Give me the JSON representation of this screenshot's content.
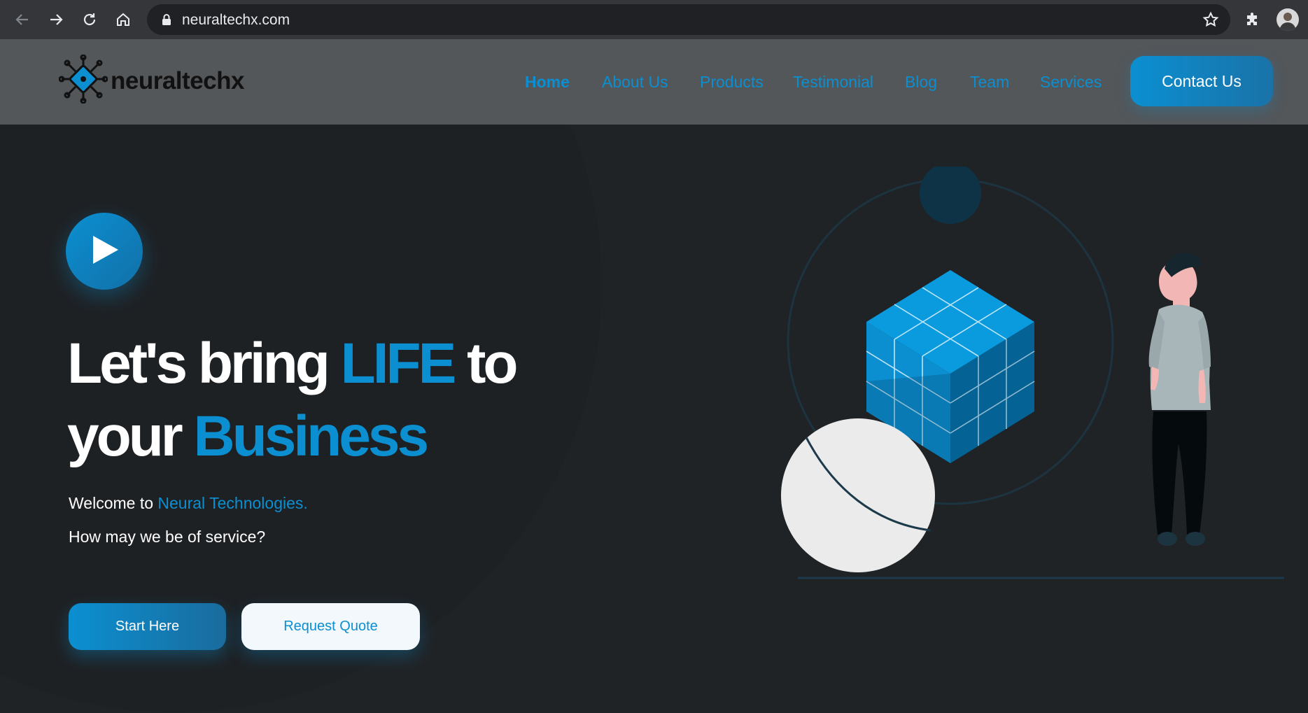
{
  "browser": {
    "url": "neuraltechx.com",
    "back_icon": "arrow-left-icon",
    "forward_icon": "arrow-right-icon",
    "reload_icon": "reload-icon",
    "home_icon": "home-icon",
    "lock_icon": "lock-icon",
    "bookmark_icon": "star-icon",
    "extensions_icon": "puzzle-icon"
  },
  "header": {
    "logo_text": "neuraltechx",
    "nav": [
      {
        "label": "Home",
        "active": true
      },
      {
        "label": "About Us"
      },
      {
        "label": "Products"
      },
      {
        "label": "Testimonial"
      },
      {
        "label": "Blog"
      },
      {
        "label": "Team"
      },
      {
        "label": "Services"
      }
    ],
    "contact_label": "Contact Us"
  },
  "hero": {
    "headline_1": "Let's bring ",
    "headline_accent_1": "LIFE",
    "headline_2": " to",
    "headline_3": "your ",
    "headline_accent_2": "Business",
    "welcome_prefix": "Welcome to ",
    "welcome_accent": "Neural Technologies.",
    "service_question": "How may we be of service?",
    "start_label": "Start Here",
    "quote_label": "Request Quote"
  },
  "colors": {
    "accent": "#0b8fd1",
    "background": "#202326",
    "header_bg": "#53575a"
  }
}
